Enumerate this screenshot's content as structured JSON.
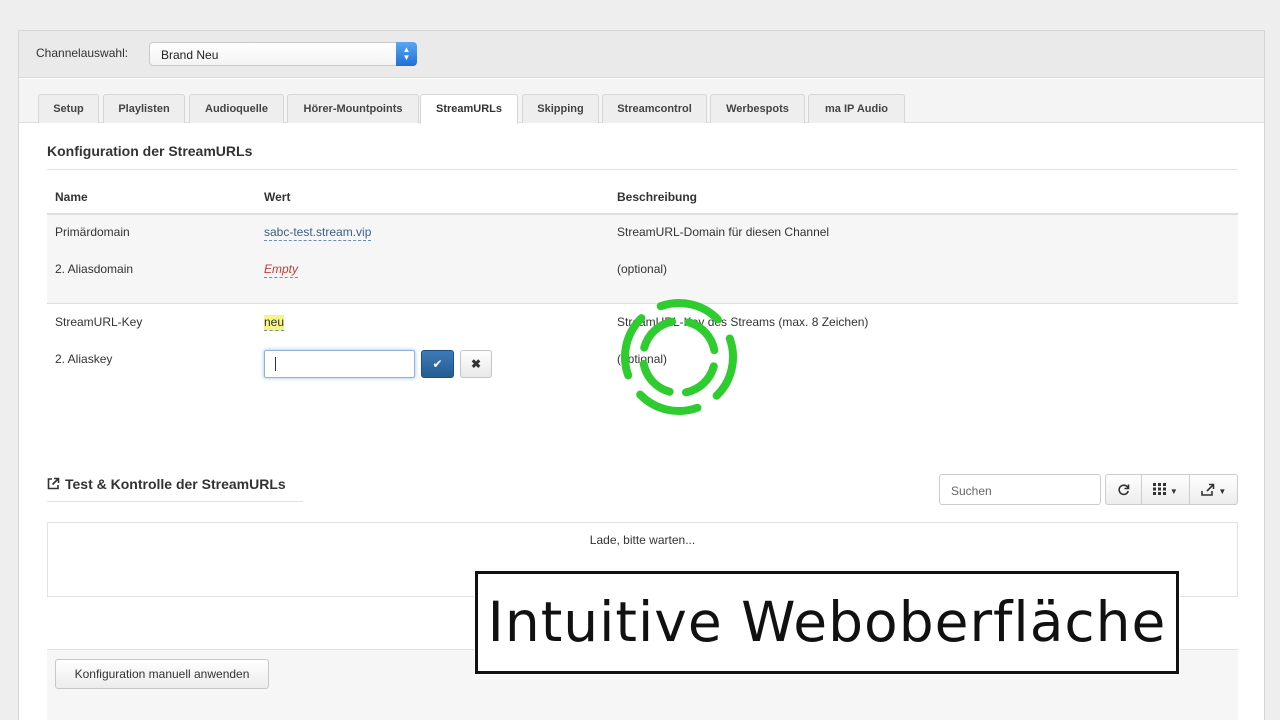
{
  "channel": {
    "label": "Channelauswahl:",
    "selected": "Brand Neu"
  },
  "tabs": [
    {
      "label": "Setup"
    },
    {
      "label": "Playlisten"
    },
    {
      "label": "Audioquelle"
    },
    {
      "label": "Hörer-Mountpoints"
    },
    {
      "label": "StreamURLs",
      "active": true
    },
    {
      "label": "Skipping"
    },
    {
      "label": "Streamcontrol"
    },
    {
      "label": "Werbespots"
    },
    {
      "label": "ma IP Audio"
    }
  ],
  "config": {
    "title": "Konfiguration der StreamURLs",
    "headers": {
      "name": "Name",
      "value": "Wert",
      "description": "Beschreibung"
    },
    "rows": [
      {
        "name": "Primärdomain",
        "value": "sabc-test.stream.vip",
        "description": "StreamURL-Domain für diesen Channel"
      },
      {
        "name": "2. Aliasdomain",
        "value": "Empty",
        "description": "(optional)"
      },
      {
        "name": "StreamURL-Key",
        "value": "neu",
        "description": "StreamURL-Key des Streams (max. 8 Zeichen)"
      },
      {
        "name": "2. Aliaskey",
        "value": "",
        "description": "(optional)"
      }
    ],
    "save_icon": "✔",
    "cancel_icon": "✖"
  },
  "test": {
    "title": "Test & Kontrolle der StreamURLs",
    "search_placeholder": "Suchen",
    "loading_text": "Lade, bitte warten...",
    "tool_icons": [
      "refresh-icon",
      "columns-icon",
      "export-icon"
    ]
  },
  "footer": {
    "apply_label": "Konfiguration manuell anwenden"
  },
  "caption": {
    "text": "Intuitive Weboberfläche"
  },
  "colors": {
    "accent": "#245c94",
    "spinner": "#2ecc2e",
    "highlight": "#f4f487",
    "empty": "#c43b3b"
  }
}
